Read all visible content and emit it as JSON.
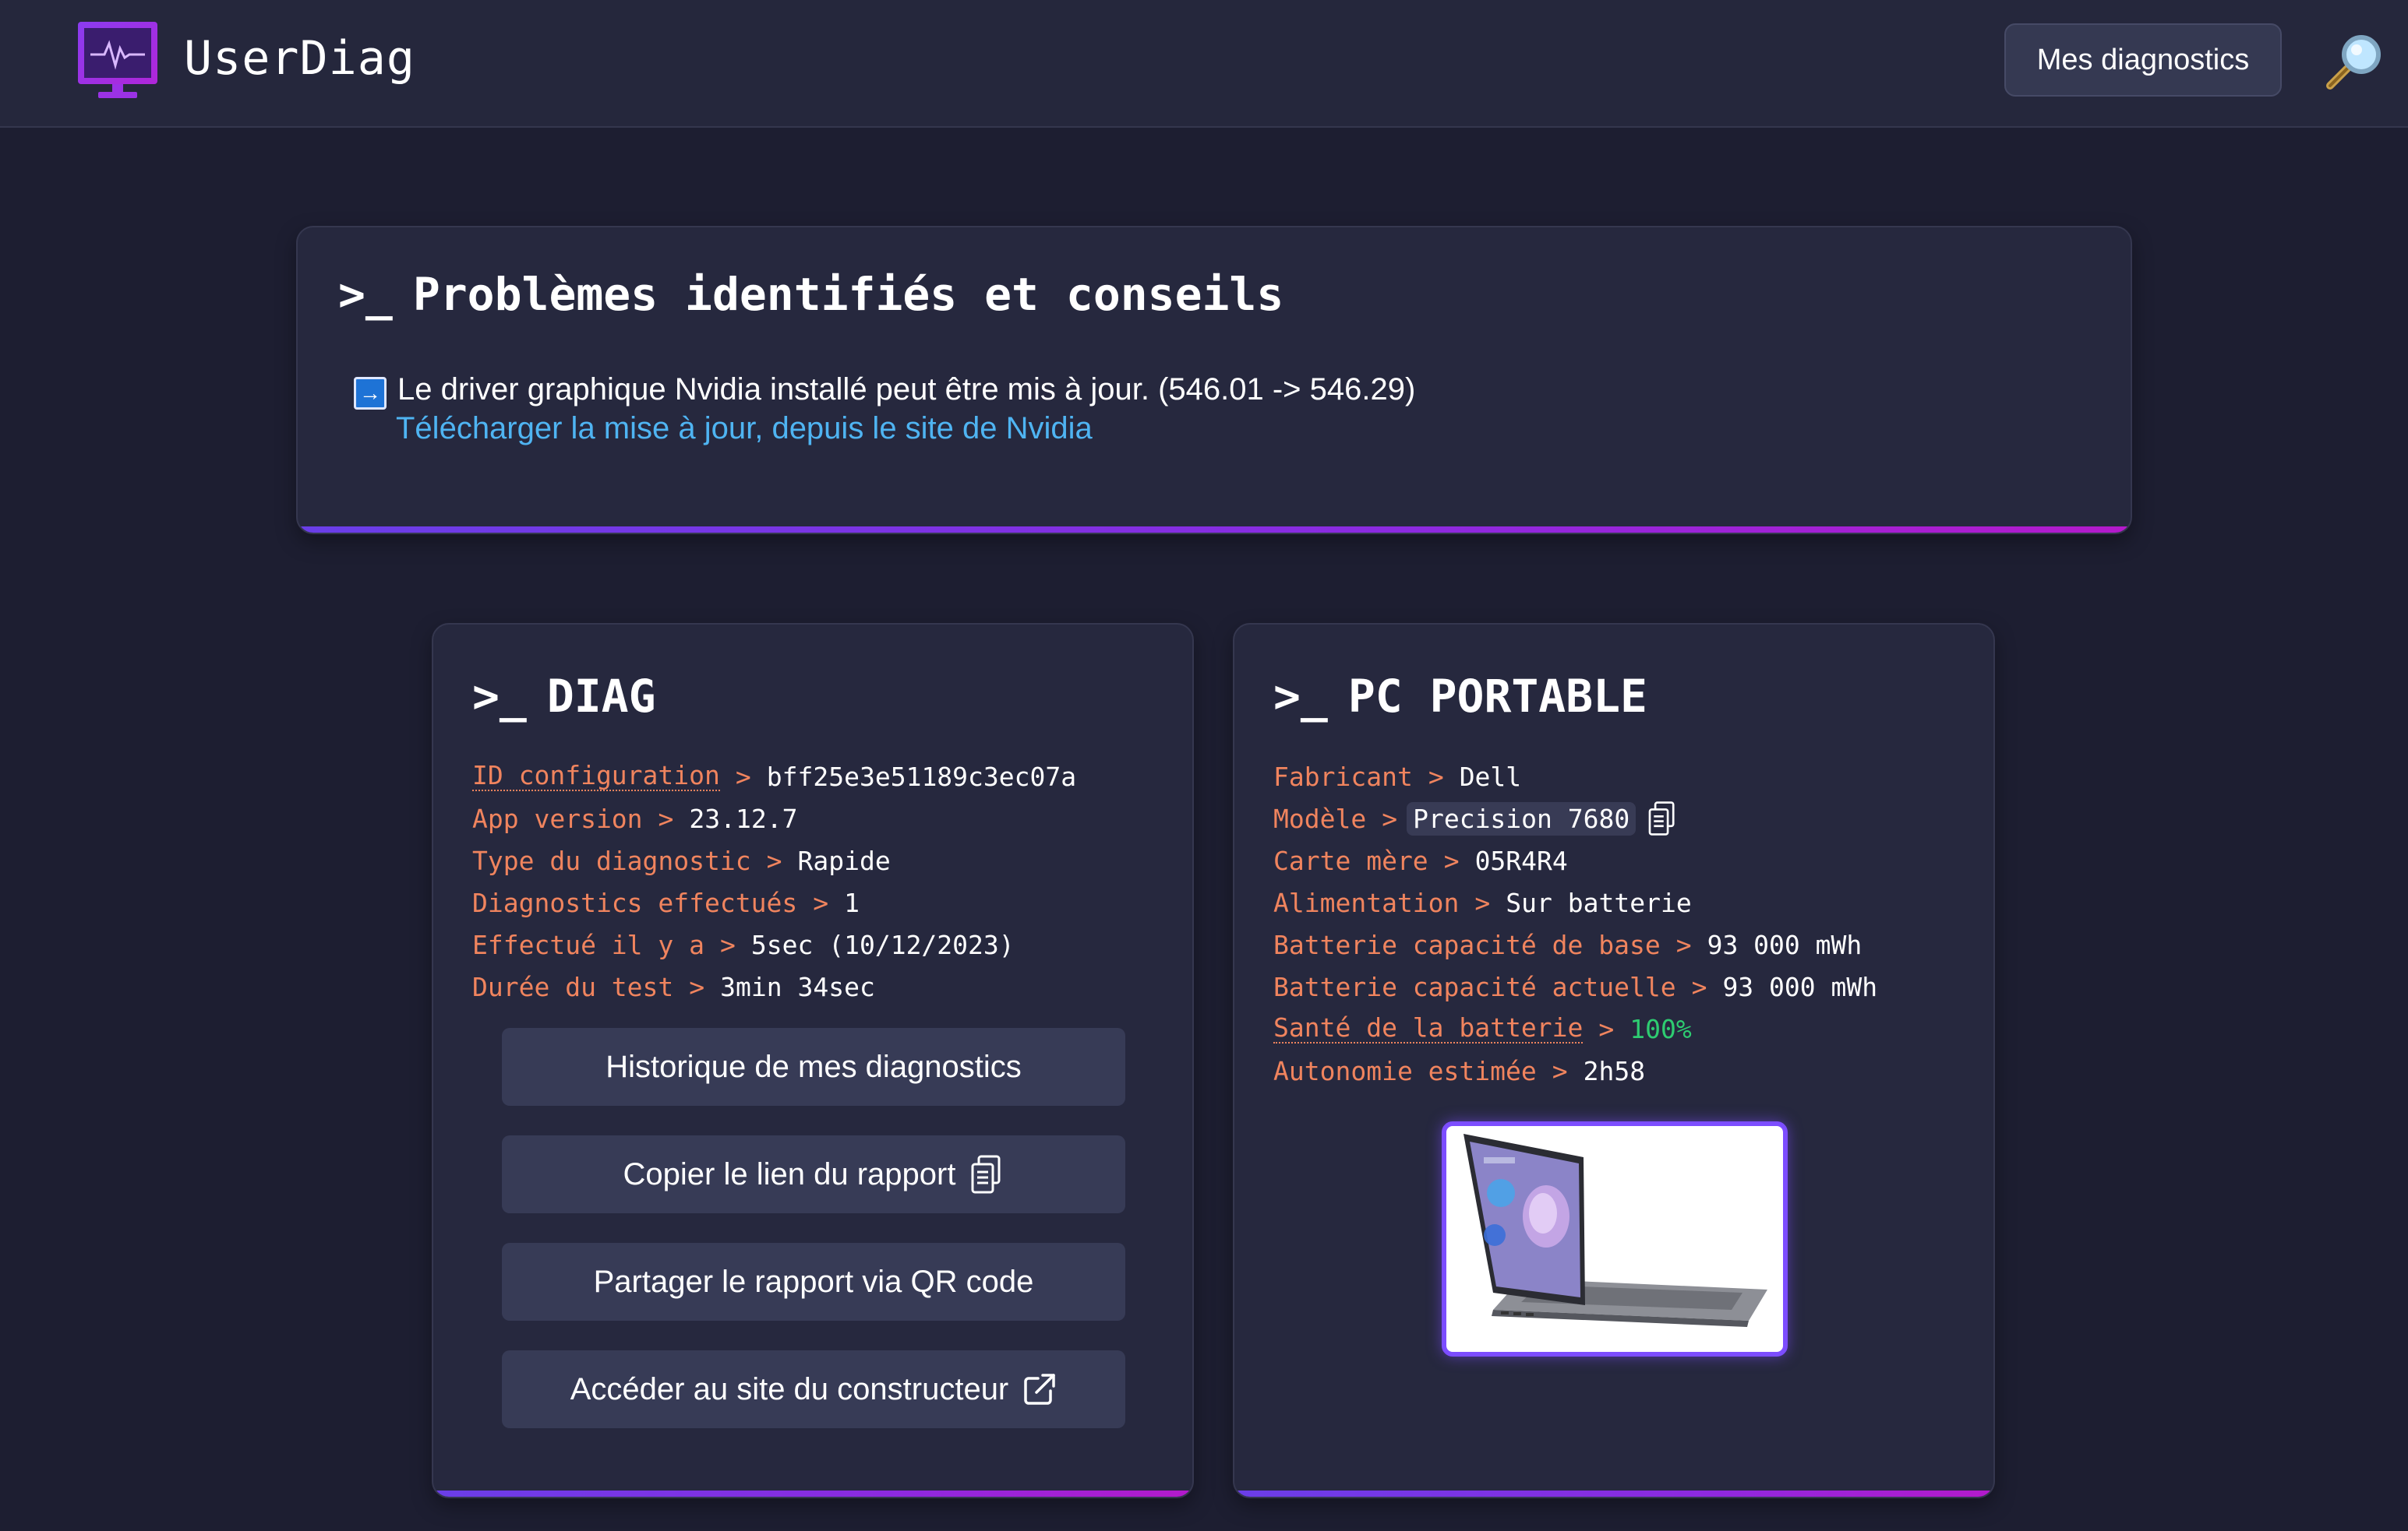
{
  "header": {
    "app_name": "UserDiag",
    "nav_button": "Mes diagnostics",
    "icons": {
      "logo": "monitor-pulse-icon",
      "search": "magnifier-icon"
    }
  },
  "problems": {
    "prompt": ">_",
    "title": "Problèmes identifiés et conseils",
    "items": [
      {
        "icon": "right-arrow-icon",
        "text": "Le driver graphique Nvidia installé peut être mis à jour. (546.01 -> 546.29)",
        "link": "Télécharger la mise à jour, depuis le site de Nvidia"
      }
    ]
  },
  "diag": {
    "prompt": ">_",
    "title": "DIAG",
    "separator": ">",
    "rows": [
      {
        "key": "ID configuration",
        "value": "bff25e3e51189c3ec07a"
      },
      {
        "key": "App version",
        "value": "23.12.7"
      },
      {
        "key": "Type du diagnostic",
        "value": "Rapide"
      },
      {
        "key": "Diagnostics effectués",
        "value": "1"
      },
      {
        "key": "Effectué il y a",
        "value": "5sec (10/12/2023)"
      },
      {
        "key": "Durée du test",
        "value": "3min 34sec"
      }
    ],
    "buttons": {
      "history": "Historique de mes diagnostics",
      "copy_link": "Copier le lien du rapport",
      "share_qr": "Partager le rapport via QR code",
      "manufacturer": "Accéder au site du constructeur"
    }
  },
  "pc": {
    "prompt": ">_",
    "title": "PC PORTABLE",
    "separator": ">",
    "rows": [
      {
        "key": "Fabricant",
        "value": "Dell"
      },
      {
        "key": "Modèle",
        "value": "Precision 7680"
      },
      {
        "key": "Carte mère",
        "value": "05R4R4"
      },
      {
        "key": "Alimentation",
        "value": "Sur batterie"
      },
      {
        "key": "Batterie capacité de base",
        "value": "93 000 mWh"
      },
      {
        "key": "Batterie capacité actuelle",
        "value": "93 000 mWh"
      },
      {
        "key": "Santé de la batterie",
        "value": "100%"
      },
      {
        "key": "Autonomie estimée",
        "value": "2h58"
      }
    ],
    "image": "laptop-photo"
  },
  "colors": {
    "background": "#1d1e31",
    "card": "#26283e",
    "key_orange": "#f0845e",
    "link_blue": "#4fb4f2",
    "good_green": "#2ecc71",
    "accent_purple": "#7c4dff"
  }
}
